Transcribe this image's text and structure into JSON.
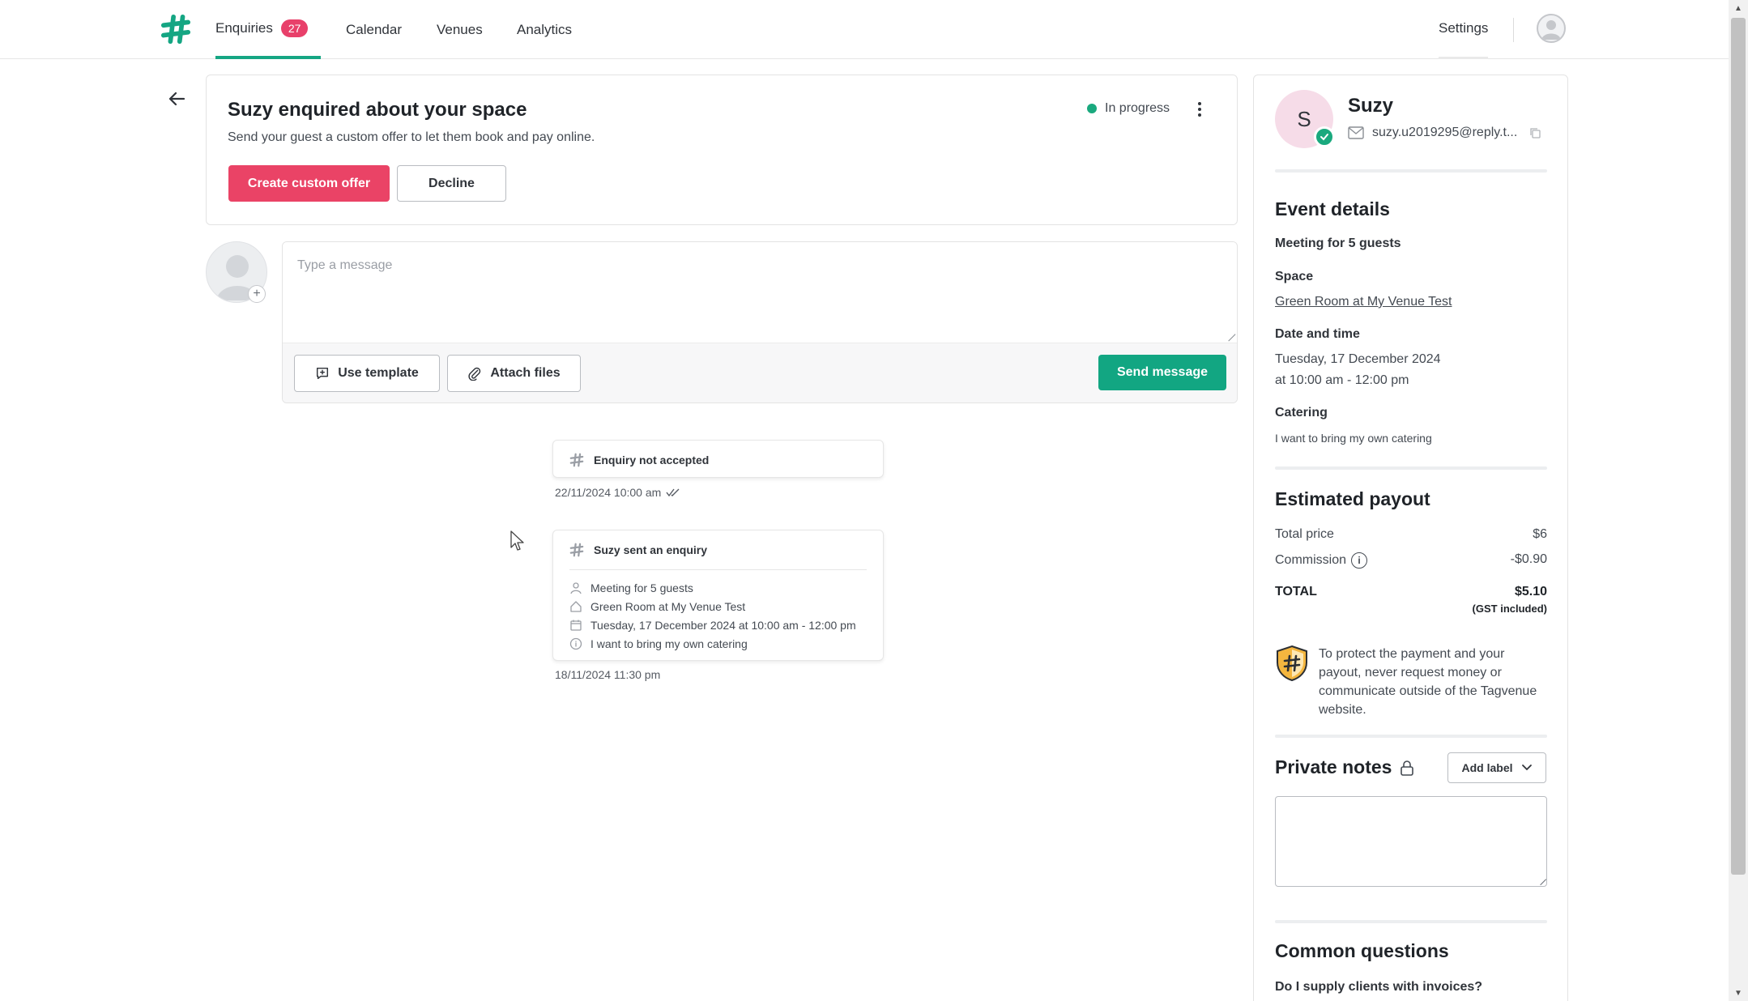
{
  "nav": {
    "items": [
      {
        "label": "Enquiries",
        "badge": "27",
        "active": true
      },
      {
        "label": "Calendar"
      },
      {
        "label": "Venues"
      },
      {
        "label": "Analytics"
      }
    ],
    "settings_label": "Settings"
  },
  "header": {
    "title": "Suzy enquired about your space",
    "subtitle": "Send your guest a custom offer to let them book and pay online.",
    "primary_button": "Create custom offer",
    "decline_button": "Decline",
    "status": "In progress",
    "status_color": "#1aa97e"
  },
  "composer": {
    "placeholder": "Type a message",
    "use_template": "Use template",
    "attach_files": "Attach files",
    "send": "Send message"
  },
  "timeline": {
    "not_accepted": {
      "title": "Enquiry not accepted",
      "time": "22/11/2024 10:00 am"
    },
    "enquiry": {
      "title": "Suzy sent an enquiry",
      "lines": [
        "Meeting for 5 guests",
        "Green Room at My Venue Test",
        "Tuesday, 17 December 2024 at 10:00 am - 12:00 pm",
        "I want to bring my own catering"
      ],
      "time": "18/11/2024 11:30 pm"
    }
  },
  "guest": {
    "initial": "S",
    "name": "Suzy",
    "email": "suzy.u2019295@reply.t..."
  },
  "event_details": {
    "heading": "Event details",
    "meeting": "Meeting for 5 guests",
    "space_label": "Space",
    "space_value": "Green Room at My Venue Test",
    "datetime_label": "Date and time",
    "date": "Tuesday, 17 December 2024",
    "time": "at 10:00 am - 12:00 pm",
    "catering_label": "Catering",
    "catering_value": "I want to bring my own catering"
  },
  "payout": {
    "heading": "Estimated payout",
    "total_price_label": "Total price",
    "total_price": "$6",
    "commission_label": "Commission",
    "commission": "-$0.90",
    "total_label": "TOTAL",
    "total": "$5.10",
    "gst": "(GST included)"
  },
  "protection_note": "To protect the payment and your payout, never request money or communicate outside of the Tagvenue website.",
  "private_notes": {
    "heading": "Private notes",
    "add_label": "Add label"
  },
  "common_questions": {
    "heading": "Common questions",
    "first_question": "Do I supply clients with invoices?"
  },
  "colors": {
    "brand_green": "#15a683",
    "accent_pink": "#ea4366"
  }
}
